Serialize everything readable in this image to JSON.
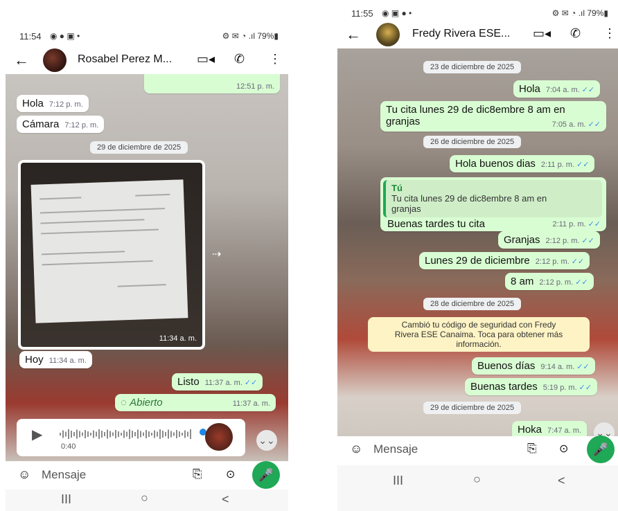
{
  "left": {
    "status": {
      "time": "11:54",
      "icons": "◉ ● ▣ •",
      "right": "⚙ ✉ ◔ .ıl 79%▮"
    },
    "header": {
      "name": "Rosabel Perez M...",
      "back_icon": "←",
      "video_icon": "▭◂",
      "call_icon": "✆",
      "menu_icon": "⋮"
    },
    "top_partial": {
      "time": "12:51 p. m."
    },
    "messages": [
      {
        "text": "Hola",
        "time": "7:12 p. m."
      },
      {
        "text": "Cámara",
        "time": "7:12 p. m."
      }
    ],
    "date_chip": "29 de diciembre de 2025",
    "photo_time": "11:34 a. m.",
    "hoy": {
      "text": "Hoy",
      "time": "11:34 a. m."
    },
    "listo": {
      "text": "Listo",
      "time": "11:37 a. m.",
      "ticks": "✓✓"
    },
    "abierto": {
      "text": "Abierto",
      "time": "11:37 a. m.",
      "icon": "◌"
    },
    "voice": {
      "duration": "0:40",
      "play_icon": "▶",
      "mic_icon": "🎤"
    },
    "scroll_icon": "⌄⌄",
    "input": {
      "placeholder": "Mensaje",
      "emoji_icon": "☺",
      "clip_icon": "⎘",
      "camera_icon": "⊙"
    },
    "mic_icon": "🎤",
    "nav": {
      "recent": "III",
      "home": "○",
      "back": "<"
    }
  },
  "right": {
    "status": {
      "time": "11:55",
      "icons": "◉ ▣ ● •",
      "right": "⚙ ✉ ◔ .ıl 79%▮"
    },
    "header": {
      "name": "Fredy Rivera ESE...",
      "back_icon": "←",
      "video_icon": "▭◂",
      "call_icon": "✆",
      "menu_icon": "⋮"
    },
    "date1": "23 de diciembre de 2025",
    "m_hola": {
      "text": "Hola",
      "time": "7:04 a. m.",
      "ticks": "✓✓"
    },
    "m_cita": {
      "line1": "Tu cita lunes 29 de dic8embre 8 am en",
      "line2": "granjas",
      "time": "7:05 a. m.",
      "ticks": "✓✓"
    },
    "date2": "26 de diciembre de 2025",
    "m_buenos": {
      "text": "Hola buenos dias",
      "time": "2:11 p. m.",
      "ticks": "✓✓"
    },
    "m_reply": {
      "quote_author": "Tú",
      "quote_line1": "Tu cita lunes 29 de dic8embre 8 am en",
      "quote_line2": "granjas",
      "text": "Buenas tardes tu cita",
      "time": "2:11 p. m.",
      "ticks": "✓✓"
    },
    "m_granjas": {
      "text": "Granjas",
      "time": "2:12 p. m.",
      "ticks": "✓✓"
    },
    "m_lunes": {
      "text": "Lunes 29 de diciembre",
      "time": "2:12 p. m.",
      "ticks": "✓✓"
    },
    "m_8am": {
      "text": "8 am",
      "time": "2:12 p. m.",
      "ticks": "✓✓"
    },
    "date3": "28 de diciembre de 2025",
    "system": {
      "line1": "Cambió tu código de seguridad con Fredy",
      "line2": "Rivera ESE Canaima. Toca para obtener más",
      "line3": "información."
    },
    "m_bdias": {
      "text": "Buenos días",
      "time": "9:14 a. m.",
      "ticks": "✓✓"
    },
    "m_btardes": {
      "text": "Buenas tardes",
      "time": "5:19 p. m.",
      "ticks": "✓✓"
    },
    "date4": "29 de diciembre de 2025",
    "m_hoka": {
      "text": "Hoka",
      "time": "7:47 a. m."
    },
    "scroll_icon": "⌄⌄",
    "input": {
      "placeholder": "Mensaje",
      "emoji_icon": "☺",
      "clip_icon": "⎘",
      "camera_icon": "⊙"
    },
    "mic_icon": "🎤",
    "nav": {
      "recent": "III",
      "home": "○",
      "back": "<"
    }
  }
}
